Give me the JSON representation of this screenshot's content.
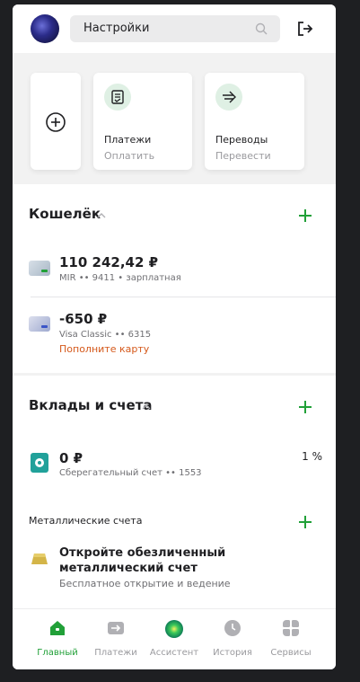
{
  "header": {
    "search_placeholder": "Настройки",
    "icons": {
      "search": "search-icon",
      "logout": "logout-icon"
    }
  },
  "quick_actions": [
    {
      "id": "add",
      "icon": "plus-circle-icon"
    },
    {
      "id": "payments",
      "title": "Платежи",
      "subtitle": "Оплатить",
      "icon": "receipt-icon"
    },
    {
      "id": "transfers",
      "title": "Переводы",
      "subtitle": "Перевести",
      "icon": "transfer-arrow-icon"
    }
  ],
  "wallet": {
    "title": "Кошелёк",
    "cards": [
      {
        "amount": "110 242,42 ₽",
        "meta": "MIR •• 9411 • зарплатная",
        "icon": "mir-card-icon"
      },
      {
        "amount": "-650 ₽",
        "meta": "Visa Classic •• 6315",
        "warning": "Пополните карту",
        "icon": "visa-card-icon"
      }
    ]
  },
  "deposits": {
    "title": "Вклады и счета",
    "account": {
      "amount": "0 ₽",
      "meta": "Сберегательный счет •• 1553",
      "rate": "1 %"
    },
    "metal": {
      "title": "Металлические счета",
      "offer_title": "Откройте обезличенный металлический счет",
      "offer_subtitle": "Бесплатное открытие и ведение"
    }
  },
  "bottom_nav": [
    {
      "label": "Главный",
      "icon": "home-icon",
      "active": true
    },
    {
      "label": "Платежи",
      "icon": "payments-icon",
      "active": false
    },
    {
      "label": "Ассистент",
      "icon": "assistant-orb-icon",
      "active": false
    },
    {
      "label": "История",
      "icon": "clock-icon",
      "active": false
    },
    {
      "label": "Сервисы",
      "icon": "grid-icon",
      "active": false
    }
  ],
  "colors": {
    "accent_green": "#21a038",
    "warning_orange": "#d5591b",
    "teal": "#21a19a",
    "gold": "#d4b548"
  }
}
